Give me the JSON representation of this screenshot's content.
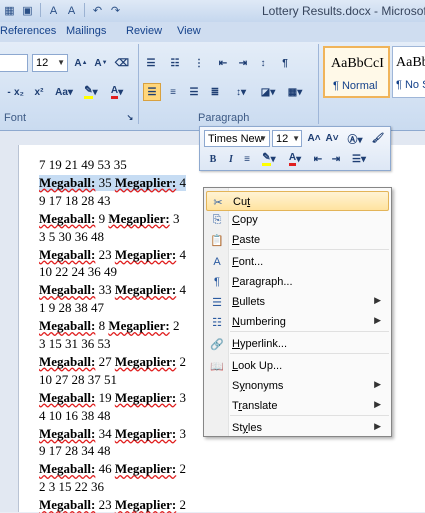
{
  "title": "Lottery Results.docx - Microsoft W",
  "qat_icons": [
    "word-logo-icon",
    "save-icon",
    "font-a-icon",
    "font-a-icon",
    "undo-icon",
    "redo-icon"
  ],
  "tabs": [
    "References",
    "Mailings",
    "Review",
    "View"
  ],
  "ribbon": {
    "font_size": "12",
    "font_group_label": "Font",
    "paragraph_group_label": "Paragraph",
    "styles": [
      {
        "preview": "AaBbCcI",
        "name": "¶ Normal"
      },
      {
        "preview": "AaBbCcI",
        "name": "¶ No S"
      }
    ]
  },
  "mini_toolbar": {
    "font": "Times New",
    "size": "12"
  },
  "document": {
    "lines": [
      {
        "type": "nums",
        "text": "7 19 21 49 53  35"
      },
      {
        "type": "mega",
        "mb": "35",
        "mp": "4",
        "selected": true
      },
      {
        "type": "nums",
        "text": "9 17 18 28 43"
      },
      {
        "type": "mega",
        "mb": "9",
        "mp": "3"
      },
      {
        "type": "nums",
        "text": "3 5 30 36 48"
      },
      {
        "type": "mega",
        "mb": "23",
        "mp": "4"
      },
      {
        "type": "nums",
        "text": "10 22 24 36 49"
      },
      {
        "type": "mega",
        "mb": "33",
        "mp": "4"
      },
      {
        "type": "nums",
        "text": "1 9 28 38 47"
      },
      {
        "type": "mega",
        "mb": "8",
        "mp": "2"
      },
      {
        "type": "nums",
        "text": "3 15 31 36 53"
      },
      {
        "type": "mega",
        "mb": "27",
        "mp": "2"
      },
      {
        "type": "nums",
        "text": "10 27 28 37 51"
      },
      {
        "type": "mega",
        "mb": "19",
        "mp": "3"
      },
      {
        "type": "nums",
        "text": "4 10 16 38 48"
      },
      {
        "type": "mega",
        "mb": "34",
        "mp": "3"
      },
      {
        "type": "nums",
        "text": "9 17 28 34 48"
      },
      {
        "type": "mega",
        "mb": "46",
        "mp": "2"
      },
      {
        "type": "nums",
        "text": "2 3 15 22 36"
      },
      {
        "type": "mega",
        "mb": "23",
        "mp": "2"
      }
    ],
    "megaball_label": "Megaball:",
    "megaplier_label": "Megaplier:"
  },
  "context_menu": {
    "items": [
      {
        "pre": "Cu",
        "key": "t",
        "post": "",
        "icon": "scissors-icon",
        "active": true
      },
      {
        "pre": "",
        "key": "C",
        "post": "opy",
        "icon": "copy-icon"
      },
      {
        "pre": "",
        "key": "P",
        "post": "aste",
        "icon": "paste-icon"
      },
      {
        "pre": "",
        "key": "F",
        "post": "ont...",
        "icon": "font-icon"
      },
      {
        "pre": "",
        "key": "P",
        "post": "aragraph...",
        "icon": "paragraph-icon"
      },
      {
        "pre": "",
        "key": "B",
        "post": "ullets",
        "icon": "bullets-icon",
        "submenu": true
      },
      {
        "pre": "",
        "key": "N",
        "post": "umbering",
        "icon": "numbering-icon",
        "submenu": true
      },
      {
        "pre": "",
        "key": "H",
        "post": "yperlink...",
        "icon": "hyperlink-icon"
      },
      {
        "pre": "",
        "key": "L",
        "post": "ook Up...",
        "icon": "research-icon"
      },
      {
        "pre": "S",
        "key": "y",
        "post": "nonyms",
        "icon": "",
        "submenu": true
      },
      {
        "pre": "T",
        "key": "r",
        "post": "anslate",
        "icon": "",
        "submenu": true
      },
      {
        "pre": "St",
        "key": "y",
        "post": "les",
        "icon": "",
        "submenu": true
      }
    ]
  }
}
